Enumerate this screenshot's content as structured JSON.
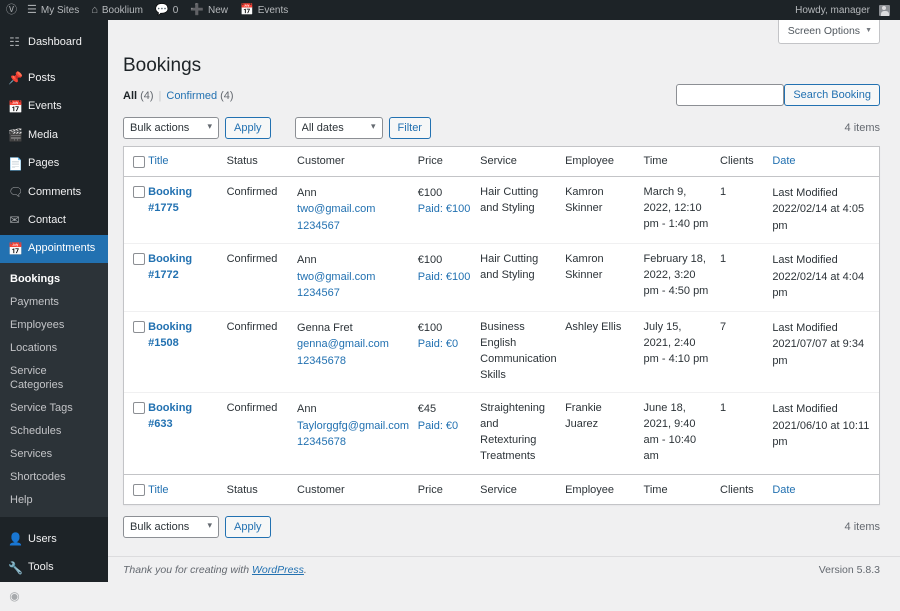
{
  "adminbar": {
    "wp_logo": "wordpress-logo",
    "items": [
      {
        "icon": "sites-icon",
        "label": "My Sites"
      },
      {
        "icon": "home-icon",
        "label": "Booklium"
      },
      {
        "icon": "comment-icon",
        "label": "0"
      },
      {
        "icon": "plus-icon",
        "label": "New"
      },
      {
        "icon": "calendar-icon",
        "label": "Events"
      }
    ],
    "howdy": "Howdy, manager"
  },
  "sidebar": {
    "top_items": [
      {
        "label": "Dashboard",
        "icon": "dashboard-icon",
        "current": false
      },
      {
        "label": "Posts",
        "icon": "pin-icon",
        "current": false
      },
      {
        "label": "Events",
        "icon": "calendar-icon",
        "current": false
      },
      {
        "label": "Media",
        "icon": "media-icon",
        "current": false
      },
      {
        "label": "Pages",
        "icon": "pages-icon",
        "current": false
      },
      {
        "label": "Comments",
        "icon": "comment-icon",
        "current": false
      },
      {
        "label": "Contact",
        "icon": "envelope-icon",
        "current": false
      },
      {
        "label": "Appointments",
        "icon": "calendar-icon",
        "current": true
      }
    ],
    "submenu": [
      {
        "label": "Bookings",
        "current": true
      },
      {
        "label": "Payments",
        "current": false
      },
      {
        "label": "Employees",
        "current": false
      },
      {
        "label": "Locations",
        "current": false
      },
      {
        "label": "Service Categories",
        "current": false
      },
      {
        "label": "Service Tags",
        "current": false
      },
      {
        "label": "Schedules",
        "current": false
      },
      {
        "label": "Services",
        "current": false
      },
      {
        "label": "Shortcodes",
        "current": false
      },
      {
        "label": "Help",
        "current": false
      }
    ],
    "bottom_items": [
      {
        "label": "Users",
        "icon": "user-icon"
      },
      {
        "label": "Tools",
        "icon": "wrench-icon"
      },
      {
        "label": "Collapse menu",
        "icon": "collapse-icon"
      }
    ]
  },
  "screen_meta": {
    "screen_options_label": "Screen Options"
  },
  "page": {
    "title": "Bookings",
    "views": {
      "all_label": "All",
      "all_count": "(4)",
      "confirmed_label": "Confirmed",
      "confirmed_count": "(4)",
      "divider": "|"
    },
    "search": {
      "value": "",
      "placeholder": "",
      "button_label": "Search Booking"
    },
    "tablenav_top": {
      "bulk_actions_selected": "Bulk actions",
      "bulk_actions_options": [
        "Bulk actions"
      ],
      "apply_label": "Apply",
      "dates_selected": "All dates",
      "dates_options": [
        "All dates"
      ],
      "filter_label": "Filter",
      "items_count": "4 items"
    },
    "tablenav_bottom": {
      "bulk_actions_selected": "Bulk actions",
      "apply_label": "Apply",
      "items_count": "4 items"
    }
  },
  "table": {
    "columns": [
      {
        "key": "title",
        "label": "Title",
        "sortable": true
      },
      {
        "key": "status",
        "label": "Status",
        "sortable": false
      },
      {
        "key": "customer",
        "label": "Customer",
        "sortable": false
      },
      {
        "key": "price",
        "label": "Price",
        "sortable": false
      },
      {
        "key": "service",
        "label": "Service",
        "sortable": false
      },
      {
        "key": "employee",
        "label": "Employee",
        "sortable": false
      },
      {
        "key": "time",
        "label": "Time",
        "sortable": false
      },
      {
        "key": "clients",
        "label": "Clients",
        "sortable": false
      },
      {
        "key": "date",
        "label": "Date",
        "sortable": true
      }
    ],
    "rows": [
      {
        "title": "Booking #1775",
        "status": "Confirmed",
        "customer_name": "Ann",
        "customer_email": "two@gmail.com",
        "customer_phone": "1234567",
        "price": "€100",
        "paid": "Paid: €100",
        "service": "Hair Cutting and Styling",
        "employee": "Kamron Skinner",
        "time": "March 9, 2022, 12:10 pm - 1:40 pm",
        "clients": "1",
        "date_label": "Last Modified",
        "date_value": "2022/02/14 at 4:05 pm"
      },
      {
        "title": "Booking #1772",
        "status": "Confirmed",
        "customer_name": "Ann",
        "customer_email": "two@gmail.com",
        "customer_phone": "1234567",
        "price": "€100",
        "paid": "Paid: €100",
        "service": "Hair Cutting and Styling",
        "employee": "Kamron Skinner",
        "time": "February 18, 2022, 3:20 pm - 4:50 pm",
        "clients": "1",
        "date_label": "Last Modified",
        "date_value": "2022/02/14 at 4:04 pm"
      },
      {
        "title": "Booking #1508",
        "status": "Confirmed",
        "customer_name": "Genna Fret",
        "customer_email": "genna@gmail.com",
        "customer_phone": "12345678",
        "price": "€100",
        "paid": "Paid: €0",
        "service": "Business English Communication Skills",
        "employee": "Ashley Ellis",
        "time": "July 15, 2021, 2:40 pm - 4:10 pm",
        "clients": "7",
        "date_label": "Last Modified",
        "date_value": "2021/07/07 at 9:34 pm"
      },
      {
        "title": "Booking #633",
        "status": "Confirmed",
        "customer_name": "Ann",
        "customer_email": "Taylorggfg@gmail.com",
        "customer_phone": "12345678",
        "price": "€45",
        "paid": "Paid: €0",
        "service": "Straightening and Retexturing Treatments",
        "employee": "Frankie Juarez",
        "time": "June 18, 2021, 9:40 am - 10:40 am",
        "clients": "1",
        "date_label": "Last Modified",
        "date_value": "2021/06/10 at 10:11 pm"
      }
    ]
  },
  "footer": {
    "thankyou_prefix": "Thank you for creating with ",
    "wordpress_link": "WordPress",
    "thankyou_suffix": ".",
    "version": "Version 5.8.3"
  },
  "colors": {
    "admin_bar_bg": "#1d2327",
    "sidebar_bg": "#1d2327",
    "submenu_bg": "#2c3338",
    "accent_blue": "#2271b1",
    "link_blue": "#2271b1",
    "page_bg": "#f0f0f1"
  }
}
